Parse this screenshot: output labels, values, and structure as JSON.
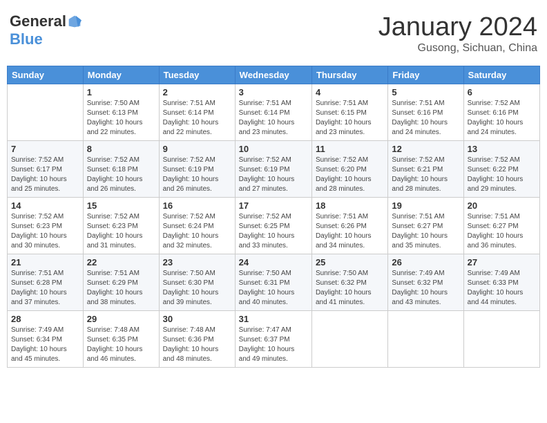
{
  "header": {
    "logo_general": "General",
    "logo_blue": "Blue",
    "month": "January 2024",
    "location": "Gusong, Sichuan, China"
  },
  "days_of_week": [
    "Sunday",
    "Monday",
    "Tuesday",
    "Wednesday",
    "Thursday",
    "Friday",
    "Saturday"
  ],
  "weeks": [
    [
      {
        "day": "",
        "info": ""
      },
      {
        "day": "1",
        "info": "Sunrise: 7:50 AM\nSunset: 6:13 PM\nDaylight: 10 hours\nand 22 minutes."
      },
      {
        "day": "2",
        "info": "Sunrise: 7:51 AM\nSunset: 6:14 PM\nDaylight: 10 hours\nand 22 minutes."
      },
      {
        "day": "3",
        "info": "Sunrise: 7:51 AM\nSunset: 6:14 PM\nDaylight: 10 hours\nand 23 minutes."
      },
      {
        "day": "4",
        "info": "Sunrise: 7:51 AM\nSunset: 6:15 PM\nDaylight: 10 hours\nand 23 minutes."
      },
      {
        "day": "5",
        "info": "Sunrise: 7:51 AM\nSunset: 6:16 PM\nDaylight: 10 hours\nand 24 minutes."
      },
      {
        "day": "6",
        "info": "Sunrise: 7:52 AM\nSunset: 6:16 PM\nDaylight: 10 hours\nand 24 minutes."
      }
    ],
    [
      {
        "day": "7",
        "info": "Sunrise: 7:52 AM\nSunset: 6:17 PM\nDaylight: 10 hours\nand 25 minutes."
      },
      {
        "day": "8",
        "info": "Sunrise: 7:52 AM\nSunset: 6:18 PM\nDaylight: 10 hours\nand 26 minutes."
      },
      {
        "day": "9",
        "info": "Sunrise: 7:52 AM\nSunset: 6:19 PM\nDaylight: 10 hours\nand 26 minutes."
      },
      {
        "day": "10",
        "info": "Sunrise: 7:52 AM\nSunset: 6:19 PM\nDaylight: 10 hours\nand 27 minutes."
      },
      {
        "day": "11",
        "info": "Sunrise: 7:52 AM\nSunset: 6:20 PM\nDaylight: 10 hours\nand 28 minutes."
      },
      {
        "day": "12",
        "info": "Sunrise: 7:52 AM\nSunset: 6:21 PM\nDaylight: 10 hours\nand 28 minutes."
      },
      {
        "day": "13",
        "info": "Sunrise: 7:52 AM\nSunset: 6:22 PM\nDaylight: 10 hours\nand 29 minutes."
      }
    ],
    [
      {
        "day": "14",
        "info": "Sunrise: 7:52 AM\nSunset: 6:23 PM\nDaylight: 10 hours\nand 30 minutes."
      },
      {
        "day": "15",
        "info": "Sunrise: 7:52 AM\nSunset: 6:23 PM\nDaylight: 10 hours\nand 31 minutes."
      },
      {
        "day": "16",
        "info": "Sunrise: 7:52 AM\nSunset: 6:24 PM\nDaylight: 10 hours\nand 32 minutes."
      },
      {
        "day": "17",
        "info": "Sunrise: 7:52 AM\nSunset: 6:25 PM\nDaylight: 10 hours\nand 33 minutes."
      },
      {
        "day": "18",
        "info": "Sunrise: 7:51 AM\nSunset: 6:26 PM\nDaylight: 10 hours\nand 34 minutes."
      },
      {
        "day": "19",
        "info": "Sunrise: 7:51 AM\nSunset: 6:27 PM\nDaylight: 10 hours\nand 35 minutes."
      },
      {
        "day": "20",
        "info": "Sunrise: 7:51 AM\nSunset: 6:27 PM\nDaylight: 10 hours\nand 36 minutes."
      }
    ],
    [
      {
        "day": "21",
        "info": "Sunrise: 7:51 AM\nSunset: 6:28 PM\nDaylight: 10 hours\nand 37 minutes."
      },
      {
        "day": "22",
        "info": "Sunrise: 7:51 AM\nSunset: 6:29 PM\nDaylight: 10 hours\nand 38 minutes."
      },
      {
        "day": "23",
        "info": "Sunrise: 7:50 AM\nSunset: 6:30 PM\nDaylight: 10 hours\nand 39 minutes."
      },
      {
        "day": "24",
        "info": "Sunrise: 7:50 AM\nSunset: 6:31 PM\nDaylight: 10 hours\nand 40 minutes."
      },
      {
        "day": "25",
        "info": "Sunrise: 7:50 AM\nSunset: 6:32 PM\nDaylight: 10 hours\nand 41 minutes."
      },
      {
        "day": "26",
        "info": "Sunrise: 7:49 AM\nSunset: 6:32 PM\nDaylight: 10 hours\nand 43 minutes."
      },
      {
        "day": "27",
        "info": "Sunrise: 7:49 AM\nSunset: 6:33 PM\nDaylight: 10 hours\nand 44 minutes."
      }
    ],
    [
      {
        "day": "28",
        "info": "Sunrise: 7:49 AM\nSunset: 6:34 PM\nDaylight: 10 hours\nand 45 minutes."
      },
      {
        "day": "29",
        "info": "Sunrise: 7:48 AM\nSunset: 6:35 PM\nDaylight: 10 hours\nand 46 minutes."
      },
      {
        "day": "30",
        "info": "Sunrise: 7:48 AM\nSunset: 6:36 PM\nDaylight: 10 hours\nand 48 minutes."
      },
      {
        "day": "31",
        "info": "Sunrise: 7:47 AM\nSunset: 6:37 PM\nDaylight: 10 hours\nand 49 minutes."
      },
      {
        "day": "",
        "info": ""
      },
      {
        "day": "",
        "info": ""
      },
      {
        "day": "",
        "info": ""
      }
    ]
  ]
}
